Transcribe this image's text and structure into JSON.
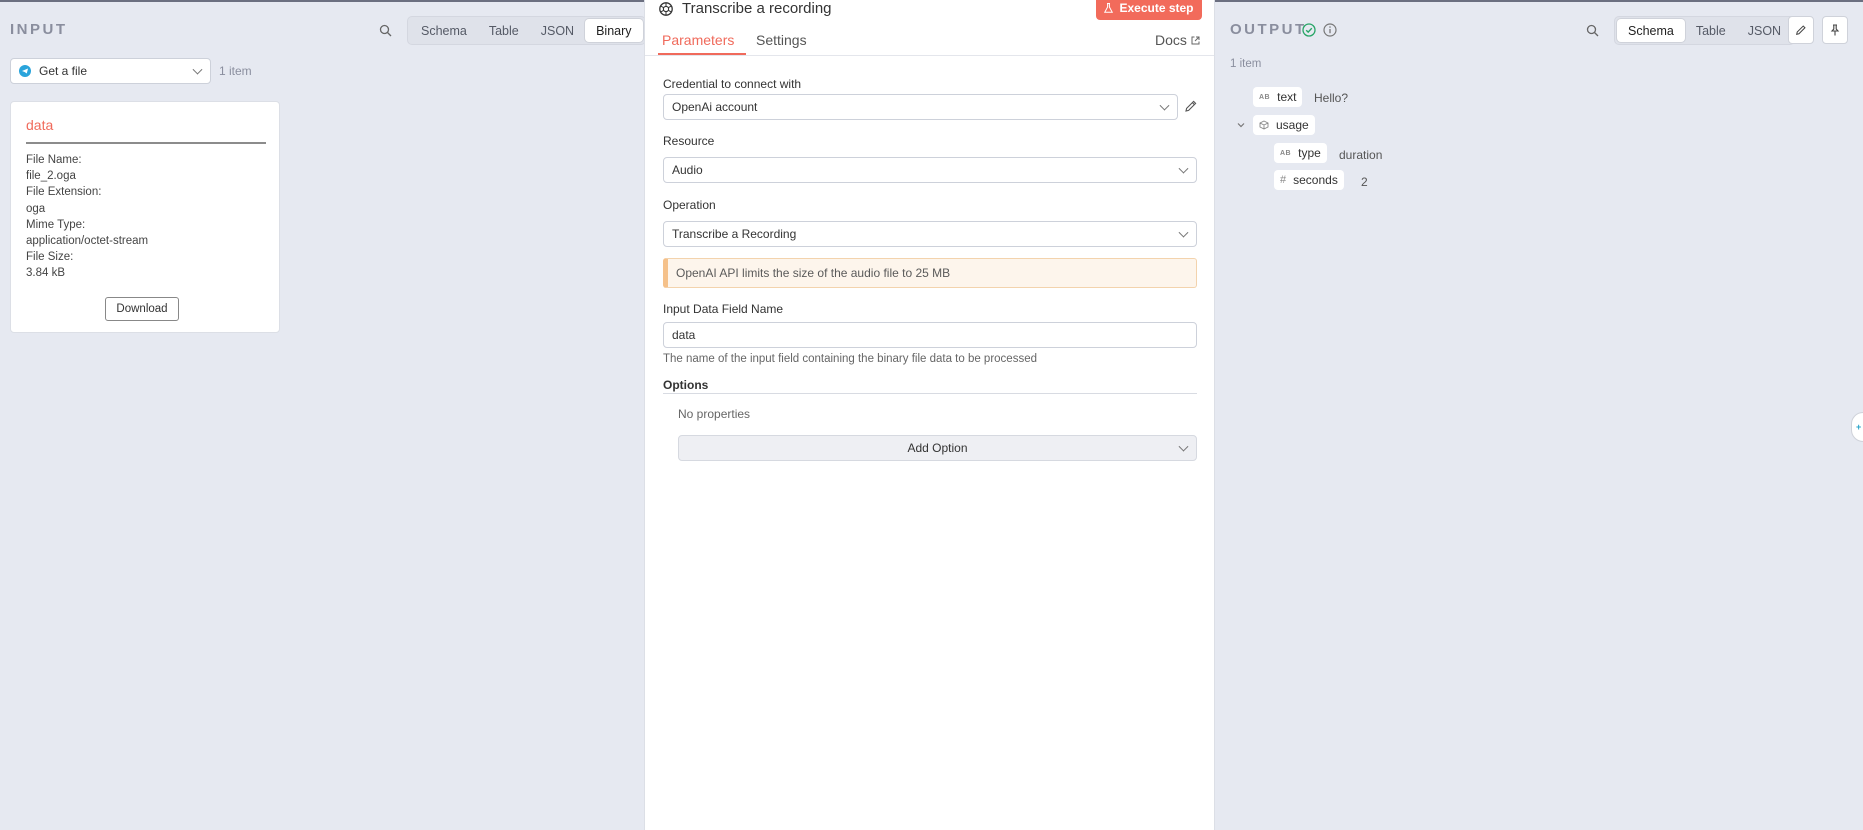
{
  "input": {
    "title": "INPUT",
    "view_options": [
      "Schema",
      "Table",
      "JSON",
      "Binary"
    ],
    "active_view": "Binary",
    "node_select": "Get a file",
    "item_count": "1 item",
    "binary_card": {
      "title": "data",
      "file_name_label": "File Name:",
      "file_name": "file_2.oga",
      "file_ext_label": "File Extension:",
      "file_ext": "oga",
      "mime_label": "Mime Type:",
      "mime": "application/octet-stream",
      "size_label": "File Size:",
      "size": "3.84 kB",
      "download_label": "Download"
    }
  },
  "node": {
    "title": "Transcribe a recording",
    "execute_label": "Execute step",
    "tabs": [
      "Parameters",
      "Settings"
    ],
    "active_tab": "Parameters",
    "docs_label": "Docs",
    "credential_label": "Credential to connect with",
    "credential_value": "OpenAi account",
    "resource_label": "Resource",
    "resource_value": "Audio",
    "operation_label": "Operation",
    "operation_value": "Transcribe a Recording",
    "notice": "OpenAI API limits the size of the audio file to 25 MB",
    "input_field_label": "Input Data Field Name",
    "input_field_value": "data",
    "input_field_hint": "The name of the input field containing the binary file data to be processed",
    "options_label": "Options",
    "no_properties": "No properties",
    "add_option_label": "Add Option"
  },
  "output": {
    "title": "OUTPUT",
    "view_options": [
      "Schema",
      "Table",
      "JSON"
    ],
    "active_view": "Schema",
    "item_count": "1 item",
    "schema": {
      "text_key": "text",
      "text_value": "Hello?",
      "usage_key": "usage",
      "type_key": "type",
      "type_value": "duration",
      "seconds_key": "seconds",
      "seconds_value": "2"
    },
    "type_badges": {
      "string": "AB",
      "number": "#"
    }
  },
  "colors": {
    "accent": "#f06a5b",
    "background": "#e6e9f1",
    "success": "#27a566",
    "notice_bg": "#fdf5ec"
  }
}
